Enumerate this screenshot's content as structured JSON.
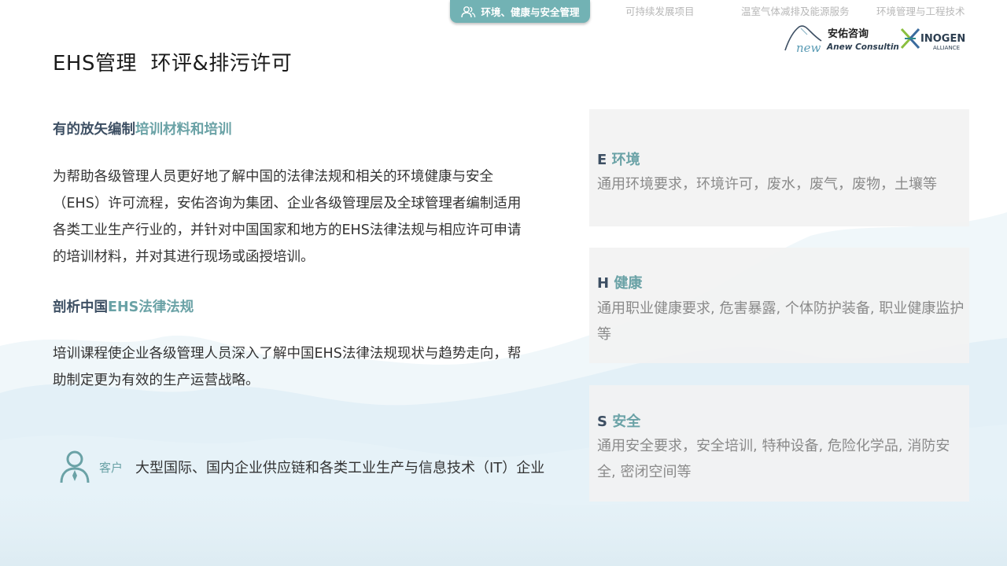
{
  "nav": {
    "active": "环境、健康与安全管理",
    "items": [
      "可持续发展项目",
      "温室气体减排及能源服务",
      "环境管理与工程技术"
    ]
  },
  "logos": {
    "anew_cn": "安佑咨询",
    "anew_en": "Anew Consulting",
    "anew_mark": "new",
    "inogen_name": "INOGEN",
    "inogen_sub": "ALLIANCE"
  },
  "title": "EHS管理  环评&排污许可",
  "section1": {
    "heading_dark": "有的放矢编制",
    "heading_teal": "培训材料和培训",
    "body": "为帮助各级管理人员更好地了解中国的法律法规和相关的环境健康与安全（EHS）许可流程，安佑咨询为集团、企业各级管理层及全球管理者编制适用各类工业生产行业的，并针对中国国家和地方的EHS法律法规与相应许可申请的培训材料，并对其进行现场或函授培训。"
  },
  "section2": {
    "heading_dark": "剖析中国",
    "heading_teal": "EHS法律法规",
    "body": "培训课程使企业各级管理人员深入了解中国EHS法律法规现状与趋势走向，帮助制定更为有效的生产运营战略。"
  },
  "client": {
    "label": "客户",
    "text": "大型国际、国内企业供应链和各类工业生产与信息技术（IT）企业"
  },
  "cards": [
    {
      "letter": "E",
      "word": "环境",
      "desc": "通用环境要求，环境许可，废水，废气，废物，土壤等"
    },
    {
      "letter": "H",
      "word": "健康",
      "desc": "通用职业健康要求, 危害暴露, 个体防护装备, 职业健康监护等"
    },
    {
      "letter": "S",
      "word": "安全",
      "desc": "通用安全要求，安全培训, 特种设备, 危险化学品, 消防安全, 密闭空间等"
    }
  ],
  "colors": {
    "teal": "#6aa2a6",
    "nav_active": "#72b2b4",
    "heading_dark": "#3d4f63",
    "card_bg": "#f2f2f2",
    "card_text": "#8a8a8a"
  }
}
